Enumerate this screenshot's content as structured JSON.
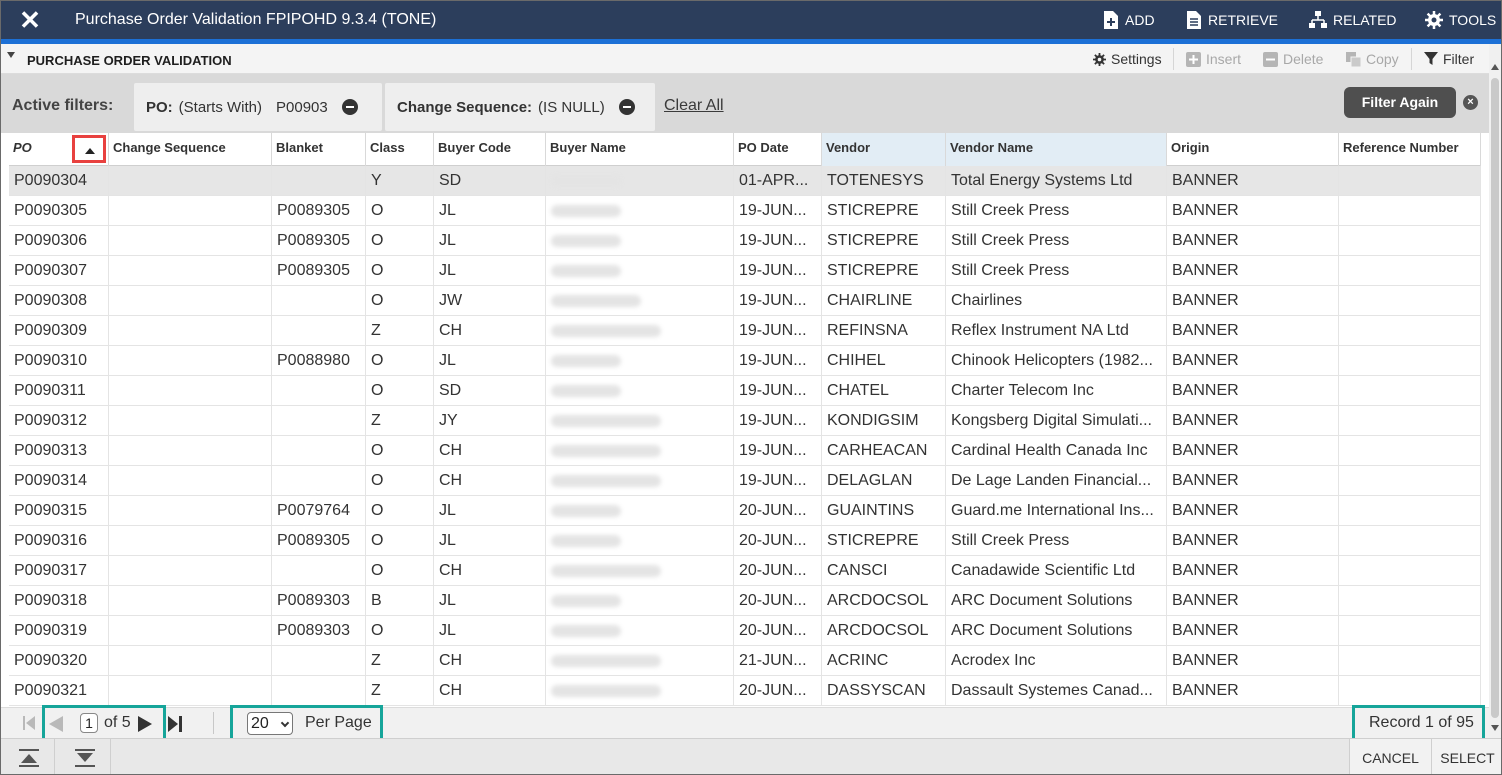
{
  "window": {
    "title": "Purchase Order Validation FPIPOHD 9.3.4 (TONE)",
    "actions": {
      "add": "ADD",
      "retrieve": "RETRIEVE",
      "related": "RELATED",
      "tools": "TOOLS"
    }
  },
  "section": {
    "title": "PURCHASE ORDER VALIDATION",
    "tools": {
      "settings": "Settings",
      "insert": "Insert",
      "delete": "Delete",
      "copy": "Copy",
      "filter": "Filter"
    }
  },
  "filters": {
    "label": "Active filters:",
    "chips": [
      {
        "field": "PO:",
        "op": "(Starts With)",
        "value": "P00903"
      },
      {
        "field": "Change Sequence:",
        "op": "(IS NULL)",
        "value": ""
      }
    ],
    "clear_all": "Clear All",
    "filter_again": "Filter Again"
  },
  "grid": {
    "columns": [
      "PO",
      "Change Sequence",
      "Blanket",
      "Class",
      "Buyer Code",
      "Buyer Name",
      "PO Date",
      "Vendor",
      "Vendor Name",
      "Origin",
      "Reference Number"
    ],
    "rows": [
      [
        "P0090304",
        "",
        "",
        "Y",
        "SD",
        "",
        "01-APR...",
        "TOTENESYS",
        "Total Energy Systems Ltd",
        "BANNER",
        ""
      ],
      [
        "P0090305",
        "",
        "P0089305",
        "O",
        "JL",
        "",
        "19-JUN...",
        "STICREPRE",
        "Still Creek Press",
        "BANNER",
        ""
      ],
      [
        "P0090306",
        "",
        "P0089305",
        "O",
        "JL",
        "",
        "19-JUN...",
        "STICREPRE",
        "Still Creek Press",
        "BANNER",
        ""
      ],
      [
        "P0090307",
        "",
        "P0089305",
        "O",
        "JL",
        "",
        "19-JUN...",
        "STICREPRE",
        "Still Creek Press",
        "BANNER",
        ""
      ],
      [
        "P0090308",
        "",
        "",
        "O",
        "JW",
        "",
        "19-JUN...",
        "CHAIRLINE",
        "Chairlines",
        "BANNER",
        ""
      ],
      [
        "P0090309",
        "",
        "",
        "Z",
        "CH",
        "",
        "19-JUN...",
        "REFINSNA",
        "Reflex Instrument NA Ltd",
        "BANNER",
        ""
      ],
      [
        "P0090310",
        "",
        "P0088980",
        "O",
        "JL",
        "",
        "19-JUN...",
        "CHIHEL",
        "Chinook Helicopters (1982...",
        "BANNER",
        ""
      ],
      [
        "P0090311",
        "",
        "",
        "O",
        "SD",
        "",
        "19-JUN...",
        "CHATEL",
        "Charter Telecom Inc",
        "BANNER",
        ""
      ],
      [
        "P0090312",
        "",
        "",
        "Z",
        "JY",
        "",
        "19-JUN...",
        "KONDIGSIM",
        "Kongsberg Digital Simulati...",
        "BANNER",
        ""
      ],
      [
        "P0090313",
        "",
        "",
        "O",
        "CH",
        "",
        "19-JUN...",
        "CARHEACAN",
        "Cardinal Health Canada Inc",
        "BANNER",
        ""
      ],
      [
        "P0090314",
        "",
        "",
        "O",
        "CH",
        "",
        "19-JUN...",
        "DELAGLAN",
        "De Lage Landen Financial...",
        "BANNER",
        ""
      ],
      [
        "P0090315",
        "",
        "P0079764",
        "O",
        "JL",
        "",
        "20-JUN...",
        "GUAINTINS",
        "Guard.me International Ins...",
        "BANNER",
        ""
      ],
      [
        "P0090316",
        "",
        "P0089305",
        "O",
        "JL",
        "",
        "20-JUN...",
        "STICREPRE",
        "Still Creek Press",
        "BANNER",
        ""
      ],
      [
        "P0090317",
        "",
        "",
        "O",
        "CH",
        "",
        "20-JUN...",
        "CANSCI",
        "Canadawide Scientific Ltd",
        "BANNER",
        ""
      ],
      [
        "P0090318",
        "",
        "P0089303",
        "B",
        "JL",
        "",
        "20-JUN...",
        "ARCDOCSOL",
        "ARC Document Solutions",
        "BANNER",
        ""
      ],
      [
        "P0090319",
        "",
        "P0089303",
        "O",
        "JL",
        "",
        "20-JUN...",
        "ARCDOCSOL",
        "ARC Document Solutions",
        "BANNER",
        ""
      ],
      [
        "P0090320",
        "",
        "",
        "Z",
        "CH",
        "",
        "21-JUN...",
        "ACRINC",
        "Acrodex Inc",
        "BANNER",
        ""
      ],
      [
        "P0090321",
        "",
        "",
        "Z",
        "CH",
        "",
        "20-JUN...",
        "DASSYSCAN",
        "Dassault Systemes Canad...",
        "BANNER",
        ""
      ]
    ]
  },
  "pager": {
    "page": "1",
    "of_pages": "of 5",
    "per_page_value": "20",
    "per_page_label": "Per Page",
    "record": "Record 1 of 95"
  },
  "footer": {
    "cancel": "CANCEL",
    "select": "SELECT"
  },
  "colors": {
    "topbar": "#2c3e5c",
    "accent": "#1c70d6",
    "highlight": "#16a59a",
    "sort_highlight": "#e8413f"
  }
}
